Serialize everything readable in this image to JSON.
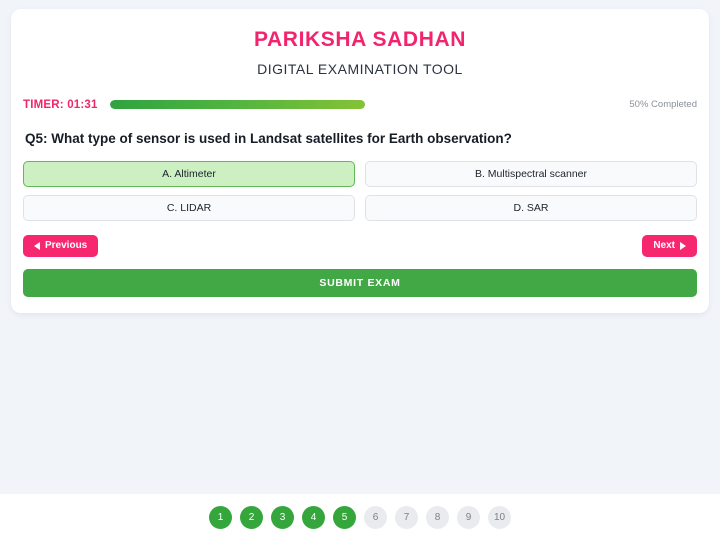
{
  "app": {
    "title": "PARIKSHA SADHAN",
    "subtitle": "DIGITAL EXAMINATION TOOL",
    "brand_color": "#f2246c",
    "accent_green": "#42a846",
    "background": "#f1f4f9"
  },
  "progress": {
    "timer_label": "TIMER: 01:31",
    "percent": 50,
    "percent_label": "50% Completed",
    "fill_gradient_start": "#2fa33f",
    "fill_gradient_end": "#84c236"
  },
  "question": {
    "text": "Q5: What type of sensor is used in Landsat satellites for Earth observation?",
    "number": 5,
    "options": [
      {
        "label": "A. Altimeter",
        "selected": true
      },
      {
        "label": "B. Multispectral scanner",
        "selected": false
      },
      {
        "label": "C. LIDAR",
        "selected": false
      },
      {
        "label": "D. SAR",
        "selected": false
      }
    ]
  },
  "navigation": {
    "previous_label": "Previous",
    "next_label": "Next",
    "previous_icon": "triangle-left-icon",
    "next_icon": "triangle-right-icon"
  },
  "submit": {
    "label": "SUBMIT EXAM"
  },
  "pager": {
    "items": [
      {
        "label": "1",
        "state": "done"
      },
      {
        "label": "2",
        "state": "done"
      },
      {
        "label": "3",
        "state": "done"
      },
      {
        "label": "4",
        "state": "done"
      },
      {
        "label": "5",
        "state": "done"
      },
      {
        "label": "6",
        "state": "todo"
      },
      {
        "label": "7",
        "state": "todo"
      },
      {
        "label": "8",
        "state": "todo"
      },
      {
        "label": "9",
        "state": "todo"
      },
      {
        "label": "10",
        "state": "todo"
      }
    ]
  }
}
